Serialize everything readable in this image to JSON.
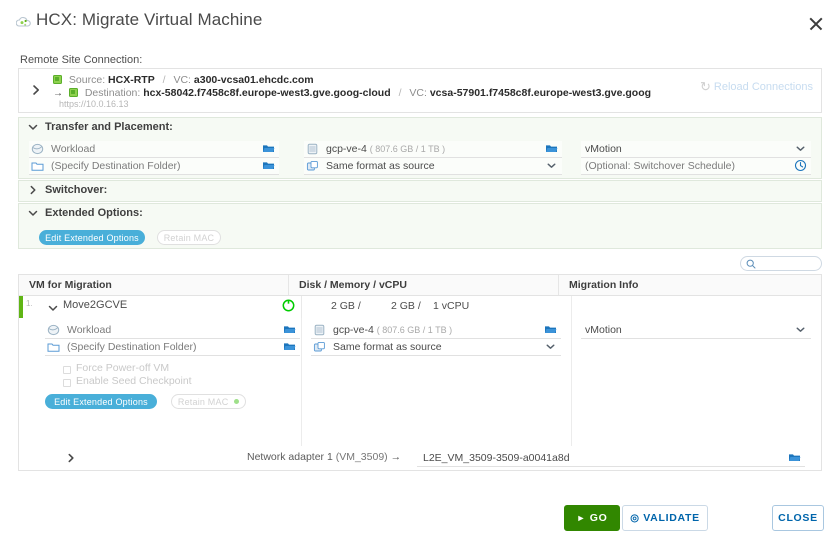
{
  "window": {
    "title": "HCX: Migrate Virtual Machine",
    "icon": "hcx-cloud-icon",
    "close_label": "×"
  },
  "remote_site": {
    "section_label": "Remote Site Connection:",
    "source_label": "Source:",
    "source_value": "HCX-RTP",
    "source_vc_label": "VC:",
    "source_vc_value": "a300-vcsa01.ehcdc.com",
    "destination_label": "Destination:",
    "destination_value": "hcx-58042.f7458c8f.europe-west3.gve.goog-cloud",
    "destination_vc_label": "VC:",
    "destination_vc_value": "vcsa-57901.f7458c8f.europe-west3.gve.goog",
    "url": "https://10.0.16.13",
    "separator": "/",
    "reload_label": "Reload Connections",
    "reload_icon": "refresh-icon"
  },
  "transfer": {
    "header": "Transfer and Placement:",
    "compute": "Workload",
    "folder": "(Specify Destination Folder)",
    "datastore": "gcp-ve-4",
    "datastore_capacity": "( 807.6 GB / 1 TB )",
    "disk_format": "Same format as source",
    "migration_type": "vMotion",
    "schedule": "(Optional: Switchover Schedule)"
  },
  "switchover": {
    "header": "Switchover:"
  },
  "extended": {
    "header": "Extended Options:",
    "edit_button": "Edit Extended Options",
    "retain_mac_button": "Retain MAC"
  },
  "search": {
    "placeholder": "",
    "value": "",
    "icon": "search-icon"
  },
  "table": {
    "columns": [
      "VM for Migration",
      "Disk / Memory / vCPU",
      "Migration Info"
    ],
    "rows": [
      {
        "index": "1.",
        "name": "Move2GCVE",
        "power_state_icon": "power-on-icon",
        "disk": "2 GB /",
        "memory": "2 GB /",
        "vcpu": "1 vCPU",
        "compute": "Workload",
        "folder": "(Specify Destination Folder)",
        "datastore": "gcp-ve-4",
        "datastore_capacity": "( 807.6 GB / 1 TB )",
        "disk_format": "Same format as source",
        "migration_type": "vMotion",
        "force_power_off_label": "Force Power-off VM",
        "enable_seed_checkpoint_label": "Enable Seed Checkpoint",
        "edit_button": "Edit Extended Options",
        "retain_mac_button": "Retain MAC",
        "network_adapter_label": "Network adapter 1",
        "network_adapter_source": "(VM_3509)",
        "network_arrow": "→",
        "network_target": "L2E_VM_3509-3509-a0041a8d"
      }
    ]
  },
  "footer": {
    "go_label": "GO",
    "validate_label": "VALIDATE",
    "close_label": "CLOSE"
  },
  "colors": {
    "accent_blue": "#49afd9",
    "link_blue": "#0065ab",
    "go_green": "#318700",
    "power_green": "#60b515",
    "panel_bg": "#f6faf4"
  }
}
